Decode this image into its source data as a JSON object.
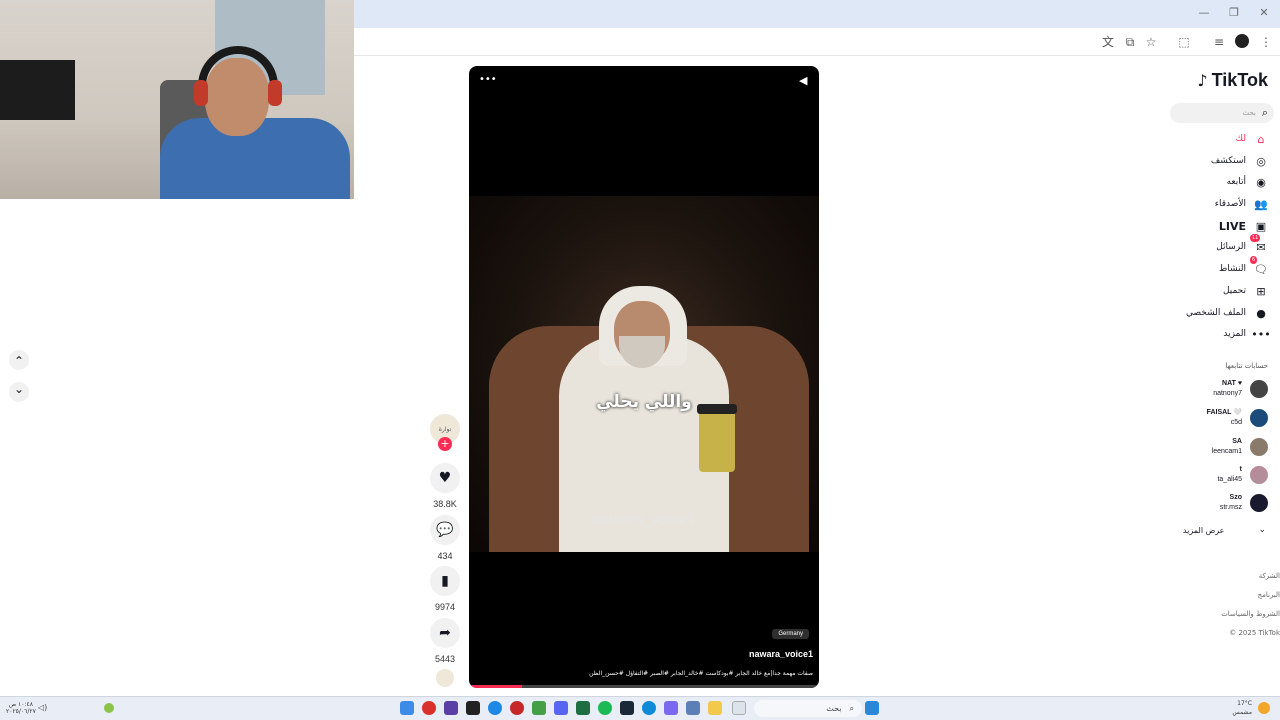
{
  "browser": {
    "window_controls": [
      "—",
      "❐",
      "✕"
    ],
    "toolbar_icons": [
      "translate-icon",
      "cast-icon",
      "star-icon",
      "extensions-icon",
      "media-icon",
      "profile-icon",
      "menu-icon"
    ]
  },
  "tiktok": {
    "logo_text": "TikTok",
    "search_placeholder": "بحث",
    "nav": [
      {
        "label": "لك",
        "icon": "home-icon",
        "active": true
      },
      {
        "label": "استكشف",
        "icon": "compass-icon"
      },
      {
        "label": "أتابعه",
        "icon": "following-icon"
      },
      {
        "label": "الأصدقاء",
        "icon": "friends-icon"
      },
      {
        "label": "LIVE",
        "icon": "live-icon"
      },
      {
        "label": "الرسائل",
        "icon": "messages-icon",
        "badge": "11"
      },
      {
        "label": "النشاط",
        "icon": "activity-icon",
        "badge": "6"
      },
      {
        "label": "تحميل",
        "icon": "upload-icon"
      },
      {
        "label": "الملف الشخصي",
        "icon": "profile-icon"
      },
      {
        "label": "المزيد",
        "icon": "more-icon"
      }
    ],
    "following_title": "حسابات تتابعها",
    "accounts": [
      {
        "name": "NAT ♥",
        "handle": "natnony7",
        "color": "#444"
      },
      {
        "name": "FAISAL 🤍",
        "handle": "c5d",
        "color": "#1b4b7a"
      },
      {
        "name": "SA",
        "handle": "leencam1",
        "color": "#8a7a6a"
      },
      {
        "name": "t",
        "handle": "ta_ali45",
        "color": "#b58c9a"
      },
      {
        "name": "Szo",
        "handle": "str.msz",
        "color": "#1a1a2e"
      }
    ],
    "see_more": "عرض المزيد",
    "footer": [
      "الشركة",
      "البرنامج",
      "الشروط والسياسات",
      "© 2025 TikTok"
    ]
  },
  "video": {
    "caption_ar": "واللي يحلي",
    "watermark": "nawara_voice1",
    "location_tag": "Germany",
    "username": "nawara_voice1",
    "description": "صفات مهمة جدا|مع خالد الجابر #بودكاست #خالد_الجابر #الصبر #التفاؤل #حسن_الظن",
    "menu_icon": "•••",
    "progress": 0.15
  },
  "actions": {
    "like_count": "38.8K",
    "comment_count": "434",
    "save_count": "9974",
    "share_count": "5443",
    "avatar_label": "نوارة"
  },
  "feed_nav": {
    "up": "⌃",
    "down": "⌄"
  },
  "taskbar": {
    "search_label": "بحث",
    "weather": "17°C",
    "weather_sub": "مشمس",
    "clock": "١٠:٤٨ ص",
    "date": "٢٠٢٥/٠٦/٢٧"
  },
  "colors": {
    "tiktok_red": "#fe2c55",
    "titlebar": "#dfe8f7"
  }
}
